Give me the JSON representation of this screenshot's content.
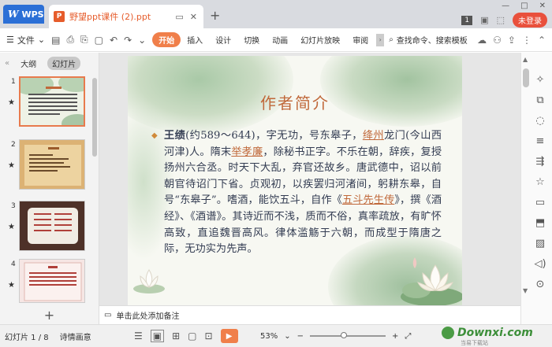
{
  "titlebar": {
    "app_label": "WPS",
    "doc_tab_name": "野望ppt课件 (2).ppt",
    "badge_num": "1",
    "login_label": "未登录"
  },
  "ribbon": {
    "file_label": "文件",
    "tabs": [
      "开始",
      "插入",
      "设计",
      "切换",
      "动画",
      "幻灯片放映",
      "审阅"
    ],
    "active_tab": "开始",
    "search_label": "查找命令、搜索模板"
  },
  "left_panel": {
    "outline_tab": "大纲",
    "slides_tab": "幻灯片",
    "thumb_numbers": [
      "1",
      "2",
      "3",
      "4"
    ]
  },
  "slide": {
    "title": "作者简介",
    "body_parts": [
      {
        "text": "王绩",
        "style": "strong"
      },
      {
        "text": "(约589～644)",
        "style": "plain"
      },
      {
        "text": "，字无功，号东皋子，",
        "style": "plain"
      },
      {
        "text": "绛州",
        "style": "link"
      },
      {
        "text": "龙门(今山西河津)人。隋末",
        "style": "plain"
      },
      {
        "text": "举孝廉",
        "style": "link"
      },
      {
        "text": "，除秘书正字。不乐在朝，辞疾，复授扬州六合丞。时天下大乱，弃官还故乡。唐武德中，诏以前朝官待诏门下省。贞观初，以疾罢归河渚间，躬耕东皋，自号“东皋子”。嗜酒，能饮五斗，自作《",
        "style": "plain"
      },
      {
        "text": "五斗先生传",
        "style": "link"
      },
      {
        "text": "》，撰《酒经》、《酒谱》。其诗近而不浅，质而不俗，真率疏放，有旷怀高致，直追魏晋高风。律体滥觞于六朝，而成型于隋唐之际，无功实为先声。",
        "style": "plain"
      }
    ]
  },
  "notes": {
    "placeholder": "单击此处添加备注"
  },
  "statusbar": {
    "slide_counter": "幻灯片 1 / 8",
    "theme_name": "诗情画意",
    "zoom_level": "53%",
    "zoom_fraction": 0.53,
    "watermark_brand": "Downxi.com",
    "watermark_sub": "当易下载站"
  },
  "colors": {
    "accent": "#f07f4a",
    "link": "#c0683a",
    "wps_blue": "#2b6fd6",
    "login_red": "#e9503c"
  }
}
